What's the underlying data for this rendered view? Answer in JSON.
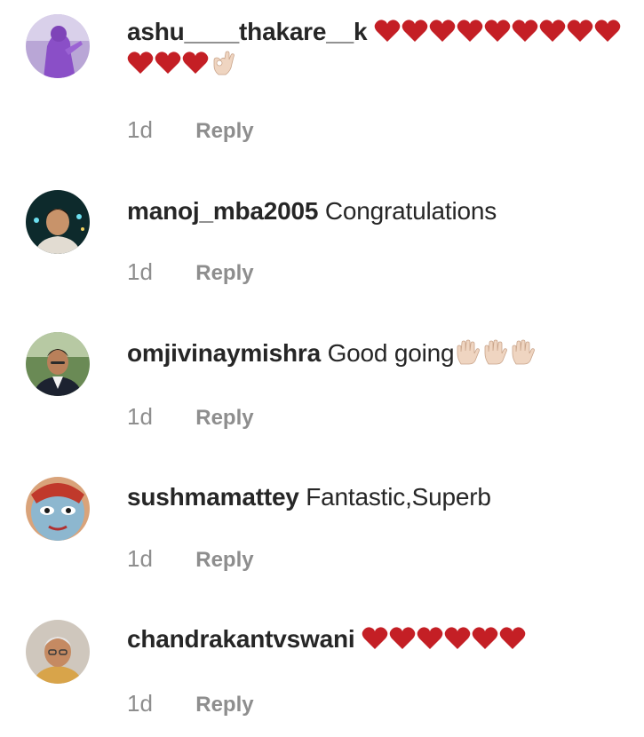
{
  "comments": [
    {
      "username": "ashu____thakare__k",
      "text": "",
      "emojis": [
        "heart",
        "heart",
        "heart",
        "heart",
        "heart",
        "heart",
        "heart",
        "heart",
        "heart",
        "heart",
        "heart",
        "heart",
        "ok-hand"
      ],
      "time": "1d",
      "reply_label": "Reply",
      "avatar_icon": "avatar-purple-figure"
    },
    {
      "username": "manoj_mba2005",
      "text": "Congratulations",
      "emojis": [],
      "time": "1d",
      "reply_label": "Reply",
      "avatar_icon": "avatar-man-night"
    },
    {
      "username": "omjivinaymishra",
      "text": "Good going",
      "emojis": [
        "raised-hand",
        "raised-hand",
        "raised-hand"
      ],
      "time": "1d",
      "reply_label": "Reply",
      "avatar_icon": "avatar-man-suit"
    },
    {
      "username": "sushmamattey",
      "text": "Fantastic,Superb",
      "emojis": [],
      "time": "1d",
      "reply_label": "Reply",
      "avatar_icon": "avatar-painted-face"
    },
    {
      "username": "chandrakantvswani",
      "text": "",
      "emojis": [
        "heart",
        "heart",
        "heart",
        "heart",
        "heart",
        "heart"
      ],
      "time": "1d",
      "reply_label": "Reply",
      "avatar_icon": "avatar-older-man"
    }
  ],
  "colors": {
    "text": "#262626",
    "secondary": "#8e8e8e",
    "heart": "#c41f25",
    "skin": "#efd5c1"
  }
}
